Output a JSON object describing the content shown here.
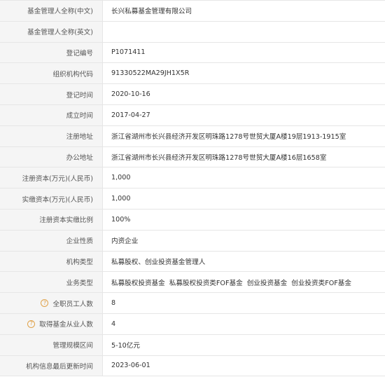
{
  "rows": [
    {
      "label": "基金管理人全称(中文)",
      "value": "长兴私募基金管理有限公司"
    },
    {
      "label": "基金管理人全称(英文)",
      "value": ""
    },
    {
      "label": "登记编号",
      "value": "P1071411"
    },
    {
      "label": "组织机构代码",
      "value": "91330522MA29JH1X5R"
    },
    {
      "label": "登记时间",
      "value": "2020-10-16"
    },
    {
      "label": "成立时间",
      "value": "2017-04-27"
    },
    {
      "label": "注册地址",
      "value": "浙江省湖州市长兴县经济开发区明珠路1278号世贸大厦A楼19层1913-1915室"
    },
    {
      "label": "办公地址",
      "value": "浙江省湖州市长兴县经济开发区明珠路1278号世贸大厦A楼16层1658室"
    },
    {
      "label": "注册资本(万元)(人民币)",
      "value": "1,000"
    },
    {
      "label": "实缴资本(万元)(人民币)",
      "value": "1,000"
    },
    {
      "label": "注册资本实缴比例",
      "value": "100%"
    },
    {
      "label": "企业性质",
      "value": "内资企业"
    },
    {
      "label": "机构类型",
      "value": "私募股权、创业投资基金管理人"
    },
    {
      "label": "业务类型",
      "tags": [
        "私募股权投资基金",
        "私募股权投资类FOF基金",
        "创业投资基金",
        "创业投资类FOF基金"
      ]
    },
    {
      "label": "全职员工人数",
      "value": "8",
      "help_icon": "question-icon",
      "help_glyph": "?"
    },
    {
      "label": "取得基金从业人数",
      "value": "4",
      "help_icon": "question-icon",
      "help_glyph": "?"
    },
    {
      "label": "管理规模区间",
      "value": "5-10亿元"
    },
    {
      "label": "机构信息最后更新时间",
      "value": "2023-06-01"
    }
  ]
}
